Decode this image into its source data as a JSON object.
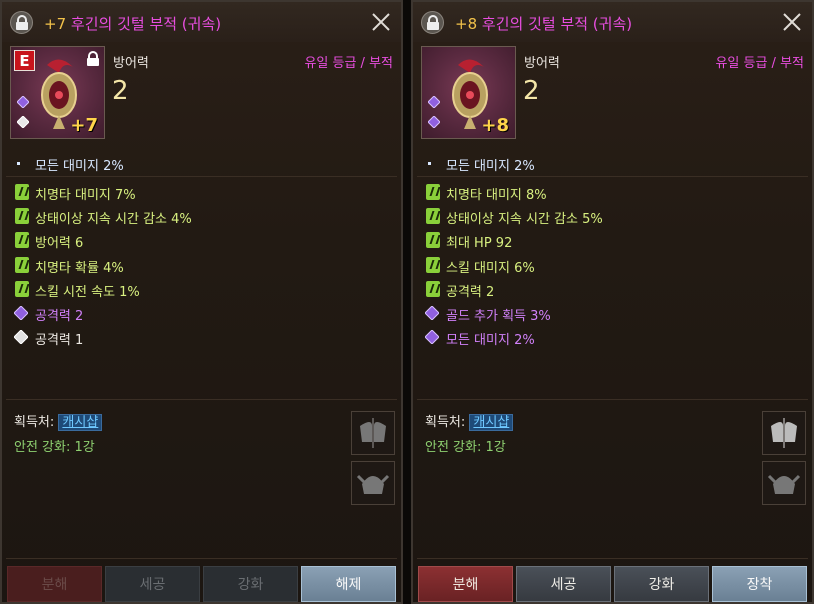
{
  "left": {
    "title_plus": "+7",
    "title_name": "후긴의 깃털 부적 (귀속)",
    "badge": "E",
    "icon_level": "+7",
    "defense_label": "방어력",
    "defense_value": "2",
    "grade": "유일 등급 / 부적",
    "base_stat": "모든 대미지 2%",
    "green_stats": [
      "치명타 대미지 7%",
      "상태이상 지속 시간 감소 4%",
      "방어력 6",
      "치명타 확률 4%",
      "스킬 시전 속도 1%"
    ],
    "purple_stats": [
      "공격력 2"
    ],
    "white_stats": [
      "공격력 1"
    ],
    "acquire_label": "획득처:",
    "acquire_link": "캐시샵",
    "safe_enhance": "안전 강화: 1강",
    "buttons": [
      "분해",
      "세공",
      "강화",
      "해제"
    ]
  },
  "right": {
    "title_plus": "+8",
    "title_name": "후긴의 깃털 부적 (귀속)",
    "icon_level": "+8",
    "defense_label": "방어력",
    "defense_value": "2",
    "grade": "유일 등급 / 부적",
    "base_stat": "모든 대미지 2%",
    "green_stats": [
      "치명타 대미지 8%",
      "상태이상 지속 시간 감소 5%",
      "최대 HP 92",
      "스킬 대미지 6%",
      "공격력 2"
    ],
    "purple_stats": [
      "골드 추가 획득 3%",
      "모든 대미지 2%"
    ],
    "acquire_label": "획득처:",
    "acquire_link": "캐시샵",
    "safe_enhance": "안전 강화: 1강",
    "buttons": [
      "분해",
      "세공",
      "강화",
      "장착"
    ]
  }
}
